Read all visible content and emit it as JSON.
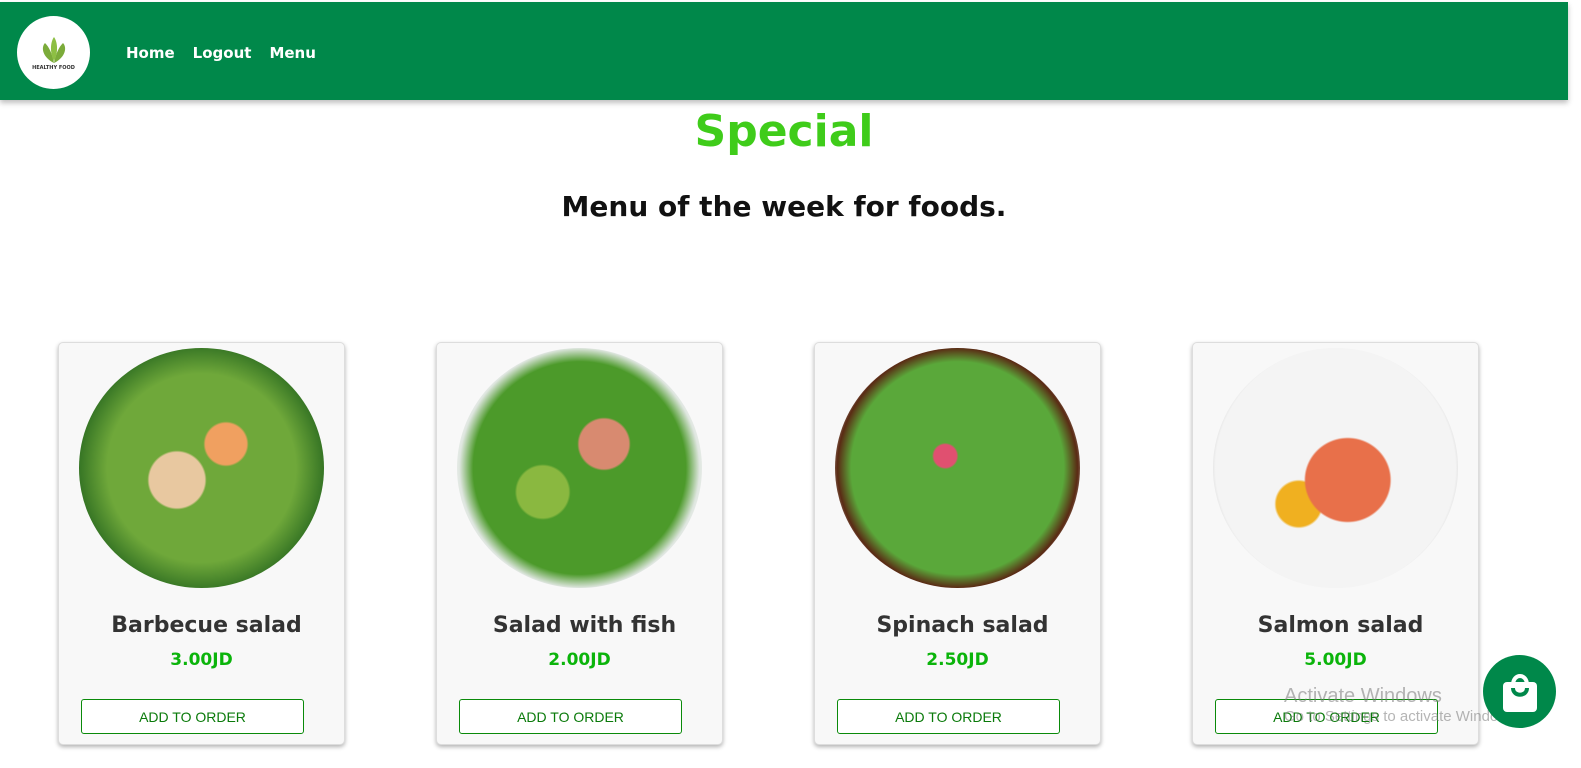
{
  "nav": {
    "logo_text": "HEALTHY FOOD",
    "links": [
      "Home",
      "Logout",
      "Menu"
    ]
  },
  "header": {
    "title": "Special",
    "subtitle": "Menu of the week for foods."
  },
  "items": [
    {
      "name": "Barbecue salad",
      "price": "3.00JD",
      "button": "ADD TO ORDER"
    },
    {
      "name": "Salad with fish",
      "price": "2.00JD",
      "button": "ADD TO ORDER"
    },
    {
      "name": "Spinach salad",
      "price": "2.50JD",
      "button": "ADD TO ORDER"
    },
    {
      "name": "Salmon salad",
      "price": "5.00JD",
      "button": "ADD TO ORDER"
    }
  ],
  "watermark": {
    "line1": "Activate Windows",
    "line2": "Go to Settings to activate Windows."
  },
  "colors": {
    "nav": "#00884a",
    "title": "#3fcc1a",
    "price": "#0bb40b"
  }
}
